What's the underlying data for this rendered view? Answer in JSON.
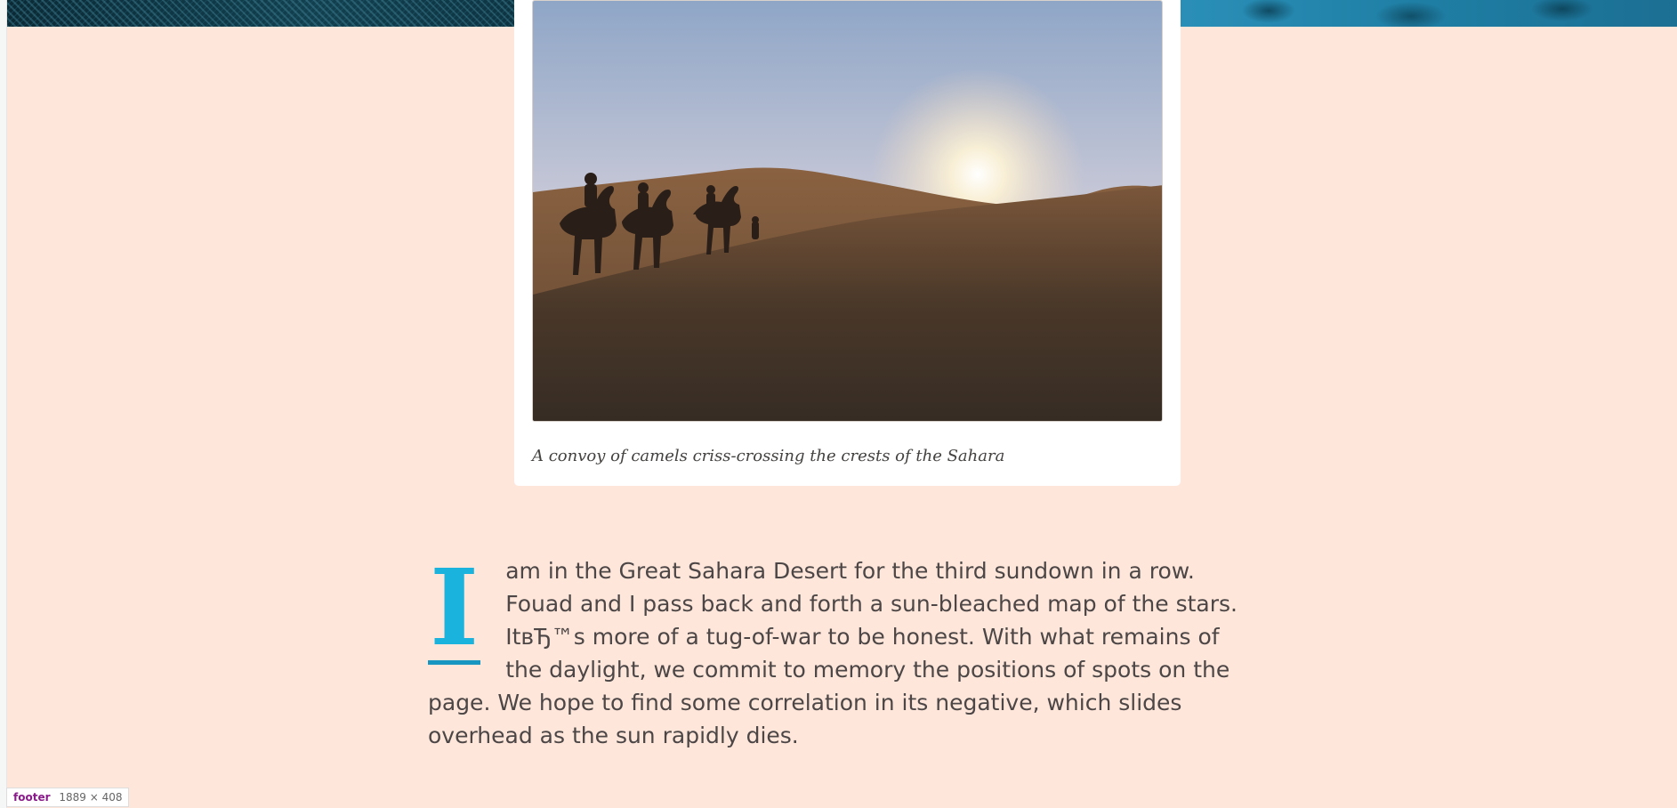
{
  "figure": {
    "image_alt": "Camel caravan silhouetted on Sahara dunes at sunset",
    "caption": "A convoy of camels criss-crossing the crests of the Sahara"
  },
  "article": {
    "drop_cap": "I",
    "paragraph": "am in the Great Sahara Desert for the third sundown in a row. Fouad and I pass back and forth a sun-bleached map of the stars. ItвЂ™s more of a tug-of-war to be honest. With what remains of the daylight, we commit to memory the positions of spots on the page. We hope to find some correlation in its negative, which slides overhead as the sun rapidly dies."
  },
  "inspector": {
    "tag": "footer",
    "size": "1889 × 408"
  },
  "colors": {
    "page_background": "#ffe6db",
    "accent": "#1ab3dd",
    "body_text": "#4c4746",
    "inspector_tag": "#8a1b8a"
  }
}
